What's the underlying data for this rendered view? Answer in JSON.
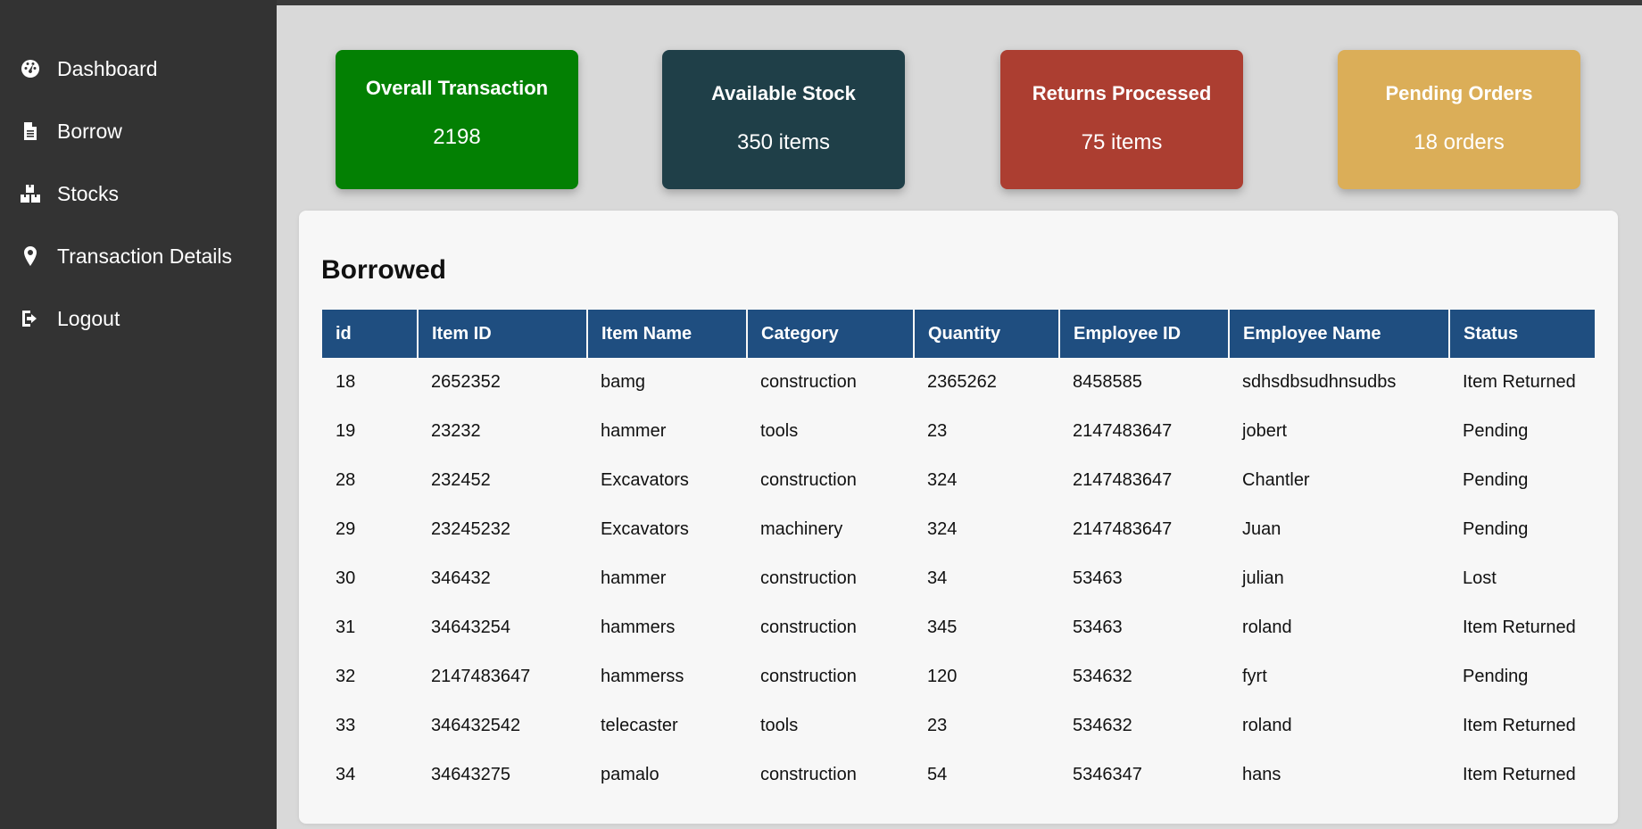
{
  "sidebar": {
    "items": [
      {
        "label": "Dashboard",
        "icon": "dashboard-icon"
      },
      {
        "label": "Borrow",
        "icon": "document-icon"
      },
      {
        "label": "Stocks",
        "icon": "boxes-icon"
      },
      {
        "label": "Transaction Details",
        "icon": "location-pin-icon"
      },
      {
        "label": "Logout",
        "icon": "logout-icon"
      }
    ]
  },
  "cards": [
    {
      "title": "Overall Transaction",
      "value": "2198",
      "color": "#038003"
    },
    {
      "title": "Available Stock",
      "value": "350 items",
      "color": "#1f3f48"
    },
    {
      "title": "Returns Processed",
      "value": "75 items",
      "color": "#ac3e31"
    },
    {
      "title": "Pending Orders",
      "value": "18 orders",
      "color": "#dbae58"
    }
  ],
  "borrowed": {
    "title": "Borrowed",
    "columns": [
      "id",
      "Item ID",
      "Item Name",
      "Category",
      "Quantity",
      "Employee ID",
      "Employee Name",
      "Status"
    ],
    "rows": [
      [
        "18",
        "2652352",
        "bamg",
        "construction",
        "2365262",
        "8458585",
        "sdhsdbsudhnsudbs",
        "Item Returned"
      ],
      [
        "19",
        "23232",
        "hammer",
        "tools",
        "23",
        "2147483647",
        "jobert",
        "Pending"
      ],
      [
        "28",
        "232452",
        "Excavators",
        "construction",
        "324",
        "2147483647",
        "Chantler",
        "Pending"
      ],
      [
        "29",
        "23245232",
        "Excavators",
        "machinery",
        "324",
        "2147483647",
        "Juan",
        "Pending"
      ],
      [
        "30",
        "346432",
        "hammer",
        "construction",
        "34",
        "53463",
        "julian",
        "Lost"
      ],
      [
        "31",
        "34643254",
        "hammers",
        "construction",
        "345",
        "53463",
        "roland",
        "Item Returned"
      ],
      [
        "32",
        "2147483647",
        "hammerss",
        "construction",
        "120",
        "534632",
        "fyrt",
        "Pending"
      ],
      [
        "33",
        "346432542",
        "telecaster",
        "tools",
        "23",
        "534632",
        "roland",
        "Item Returned"
      ],
      [
        "34",
        "34643275",
        "pamalo",
        "construction",
        "54",
        "5346347",
        "hans",
        "Item Returned"
      ]
    ]
  }
}
